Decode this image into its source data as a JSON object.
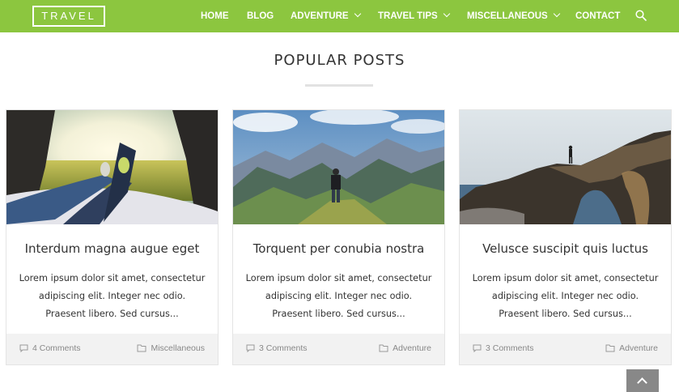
{
  "header": {
    "logo": "TRAVEL",
    "nav": [
      {
        "label": "HOME"
      },
      {
        "label": "BLOG"
      },
      {
        "label": "ADVENTURE"
      },
      {
        "label": "TRAVEL TIPS"
      },
      {
        "label": "MISCELLANEOUS"
      },
      {
        "label": "CONTACT"
      }
    ],
    "accent_color": "#8cc63f",
    "search_icon": "search-icon"
  },
  "section": {
    "title": "POPULAR POSTS"
  },
  "posts": [
    {
      "title": "Interdum magna augue eget",
      "excerpt": "Lorem ipsum dolor sit amet, consectetur adipiscing elit. Integer nec odio. Praesent libero. Sed cursus...",
      "comments": "4 Comments",
      "category": "Miscellaneous"
    },
    {
      "title": "Torquent per conubia nostra",
      "excerpt": "Lorem ipsum dolor sit amet, consectetur adipiscing elit. Integer nec odio. Praesent libero. Sed cursus...",
      "comments": "3 Comments",
      "category": "Adventure"
    },
    {
      "title": "Velusce suscipit quis luctus",
      "excerpt": "Lorem ipsum dolor sit amet, consectetur adipiscing elit. Integer nec odio. Praesent libero. Sed cursus...",
      "comments": "3 Comments",
      "category": "Adventure"
    }
  ]
}
